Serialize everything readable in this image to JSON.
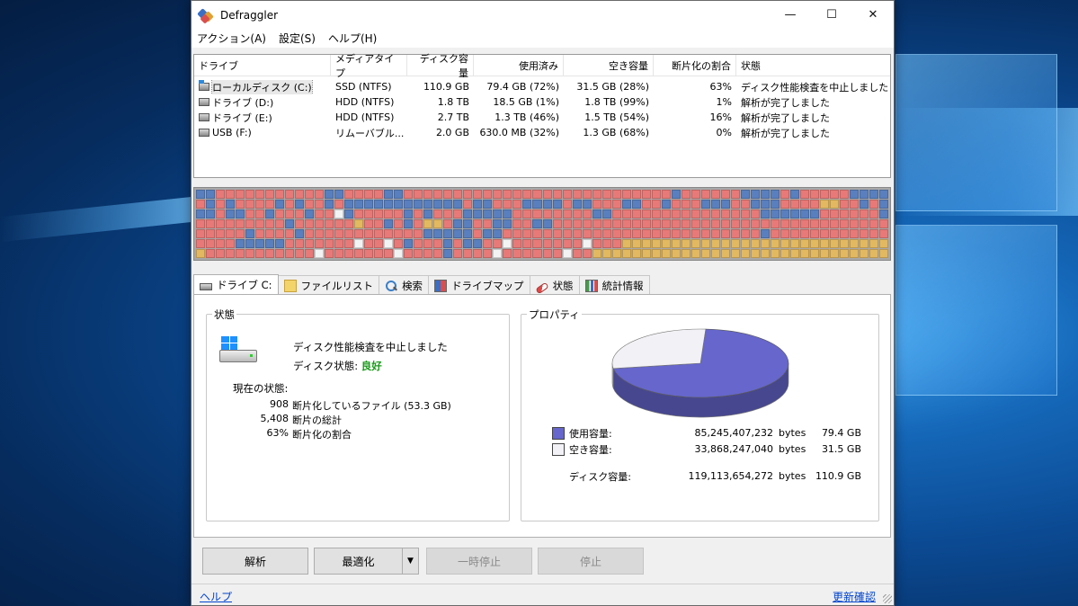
{
  "window": {
    "title": "Defraggler",
    "controls": {
      "minimize": "—",
      "maximize": "☐",
      "close": "✕"
    }
  },
  "menu": [
    "アクション(A)",
    "設定(S)",
    "ヘルプ(H)"
  ],
  "drive_list": {
    "headers": [
      "ドライブ",
      "メディアタイプ",
      "ディスク容量",
      "使用済み",
      "空き容量",
      "断片化の割合",
      "状態"
    ],
    "rows": [
      {
        "drive": "ローカルディスク (C:)",
        "media": "SSD (NTFS)",
        "size": "110.9 GB",
        "used": "79.4 GB (72%)",
        "free": "31.5 GB (28%)",
        "frag": "63%",
        "status": "ディスク性能検査を中止しました",
        "icon": "system-drive-icon"
      },
      {
        "drive": "ドライブ (D:)",
        "media": "HDD (NTFS)",
        "size": "1.8 TB",
        "used": "18.5 GB (1%)",
        "free": "1.8 TB (99%)",
        "frag": "1%",
        "status": "解析が完了しました",
        "icon": "drive-icon"
      },
      {
        "drive": "ドライブ (E:)",
        "media": "HDD (NTFS)",
        "size": "2.7 TB",
        "used": "1.3 TB (46%)",
        "free": "1.5 TB (54%)",
        "frag": "16%",
        "status": "解析が完了しました",
        "icon": "drive-icon"
      },
      {
        "drive": "USB (F:)",
        "media": "リムーバブル...",
        "size": "2.0 GB",
        "used": "630.0 MB (32%)",
        "free": "1.3 GB (68%)",
        "frag": "0%",
        "status": "解析が完了しました",
        "icon": "drive-icon"
      }
    ]
  },
  "drive_map": {
    "colors": {
      "fragmented": "#e77a78",
      "used": "#5a7fbe",
      "free": "#f3f3f3",
      "system": "#e2b861"
    },
    "rows": [
      "bbrrrrrrrrrrrbbrrrrbbrrrrrrrrrrrrrrrrrrrrrrrrrrrbrrrrrrbbbbrbrrrrrbbbbbr",
      "rbrbrrrrbrbrrbrbbbbbbbbbbbbrbbrrrbbbbrbbrrrbbrrbrrrbbbrrbbbrrrryyrrbrbbr",
      "bbrbbrrbrrrbrrwbrrrrrbrbrrrbbbbbrrrrrrrrbbrrrrrrrrrrrrrrrbbbbbbrrrrrrbbr",
      "rrrrrrrrrbrrrrrryrrbrbryyrbbrrbbrrbbrrrrrrrrrrrrrrrrrrrrrrrrrrrrrrrrrrbr",
      "rrrrrbrrrrbrrrrrrrrrrrrbbbbbrbbrrrrrrrrrrrrrrrrrrrrrrrrrrbrrrrrrrrrrrrrr",
      "rrrrbbbbbrrrrrrrwrrwrbrrrbrbbrrwrrrrrrrwrrryyyyyyyyyyyyyyyyyyyyyyyyyyyyy",
      "yrrrrrrrrrrrwrrrrrrrwrrrrbrrrrwrrrrrrwrryyyyyyyyyyyyyyyyyyyyyyyyyyyyyyy"
    ]
  },
  "tabs": [
    {
      "label": "ドライブ C:",
      "icon": "drive-icon",
      "active": true
    },
    {
      "label": "ファイルリスト",
      "icon": "folder-icon"
    },
    {
      "label": "検索",
      "icon": "search-icon"
    },
    {
      "label": "ドライブマップ",
      "icon": "map-icon"
    },
    {
      "label": "状態",
      "icon": "health-icon"
    },
    {
      "label": "統計情報",
      "icon": "stats-icon"
    }
  ],
  "status_panel": {
    "title": "状態",
    "message": "ディスク性能検査を中止しました",
    "disk_status_label": "ディスク状態:",
    "disk_status_value": "良好",
    "current_label": "現在の状態:",
    "stats": [
      {
        "value": "908",
        "label": "断片化しているファイル (53.3 GB)"
      },
      {
        "value": "5,408",
        "label": "断片の総計"
      },
      {
        "value": "63%",
        "label": "断片化の割合"
      }
    ]
  },
  "properties_panel": {
    "title": "プロパティ",
    "pie": {
      "used_fraction": 0.716,
      "used_color": "#6666cc",
      "free_color": "#f2f2f6"
    },
    "used": {
      "label": "使用容量:",
      "bytes": "85,245,407,232",
      "unit": "bytes",
      "size": "79.4 GB"
    },
    "free": {
      "label": "空き容量:",
      "bytes": "33,868,247,040",
      "unit": "bytes",
      "size": "31.5 GB"
    },
    "total": {
      "label": "ディスク容量:",
      "bytes": "119,113,654,272",
      "unit": "bytes",
      "size": "110.9 GB"
    }
  },
  "buttons": {
    "analyze": "解析",
    "defrag": "最適化",
    "dropdown": "▼",
    "pause": "一時停止",
    "stop": "停止"
  },
  "footer": {
    "help": "ヘルプ",
    "update": "更新確認"
  }
}
